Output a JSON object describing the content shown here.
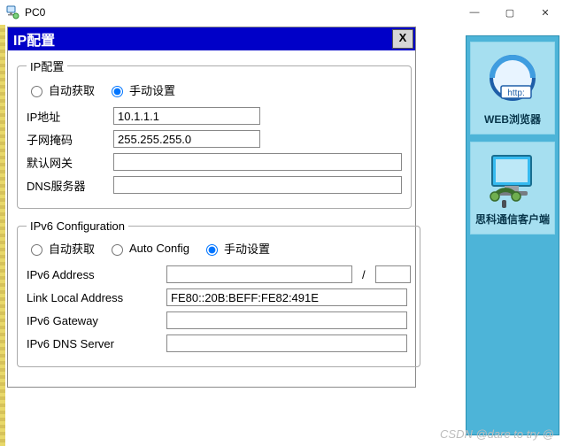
{
  "window": {
    "title": "PC0",
    "controls": {
      "min": "—",
      "max": "▢",
      "close": "✕"
    }
  },
  "dialog": {
    "title": "IP配置",
    "close": "X"
  },
  "ipv4": {
    "legend": "IP配置",
    "radio_auto": "自动获取",
    "radio_manual": "手动设置",
    "ip_label": "IP地址",
    "ip_value": "10.1.1.1",
    "mask_label": "子网掩码",
    "mask_value": "255.255.255.0",
    "gw_label": "默认网关",
    "gw_value": "",
    "dns_label": "DNS服务器",
    "dns_value": ""
  },
  "ipv6": {
    "legend": "IPv6 Configuration",
    "radio_auto": "自动获取",
    "radio_autocfg": "Auto Config",
    "radio_manual": "手动设置",
    "addr_label": "IPv6 Address",
    "addr_value": "",
    "prefix_value": "",
    "lla_label": "Link Local Address",
    "lla_value": "FE80::20B:BEFF:FE82:491E",
    "gw_label": "IPv6 Gateway",
    "gw_value": "",
    "dns_label": "IPv6 DNS Server",
    "dns_value": ""
  },
  "launcher": {
    "web_label": "WEB浏览器",
    "client_label": "思科通信客户端"
  },
  "watermark": "CSDN @dare to try @"
}
